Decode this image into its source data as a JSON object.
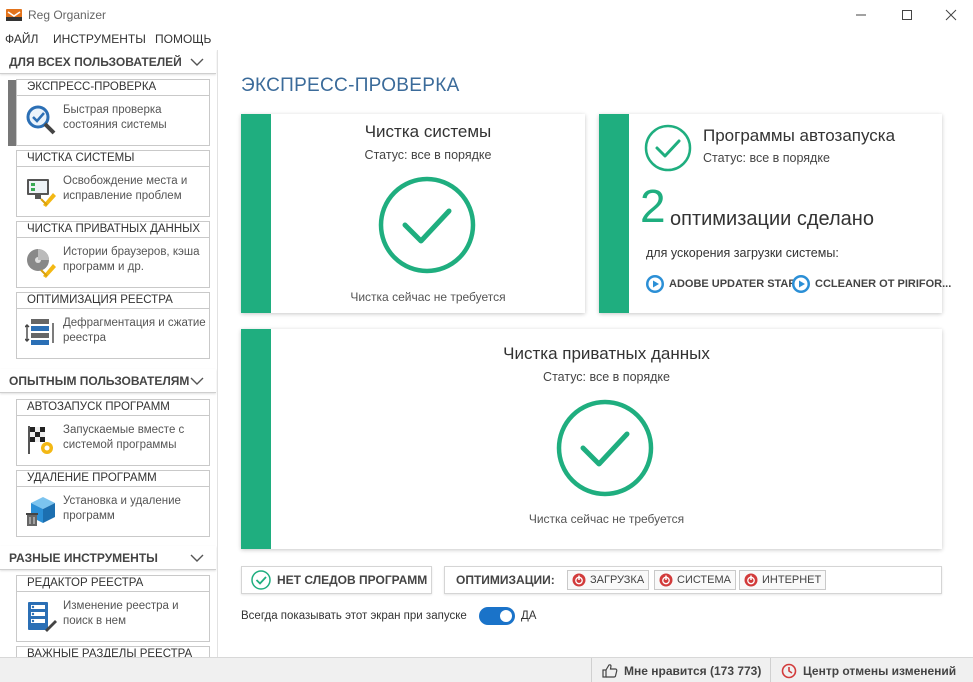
{
  "window": {
    "title": "Reg Organizer"
  },
  "menu": [
    "ФАЙЛ",
    "ИНСТРУМЕНТЫ",
    "ПОМОЩЬ"
  ],
  "sidebar": {
    "sections": [
      {
        "title": "ДЛЯ ВСЕХ ПОЛЬЗОВАТЕЛЕЙ",
        "tools": [
          {
            "name": "ЭКСПРЕСС-ПРОВЕРКА",
            "desc": "Быстрая проверка состояния системы",
            "icon": "magnifier-check-icon"
          },
          {
            "name": "ЧИСТКА СИСТЕМЫ",
            "desc": "Освобождение места и исправление проблем",
            "icon": "monitor-broom-icon"
          },
          {
            "name": "ЧИСТКА ПРИВАТНЫХ ДАННЫХ",
            "desc": "Истории браузеров, кэша программ и др.",
            "icon": "disk-broom-icon"
          },
          {
            "name": "ОПТИМИЗАЦИЯ РЕЕСТРА",
            "desc": "Дефрагментация и сжатие реестра",
            "icon": "registry-compress-icon"
          }
        ]
      },
      {
        "title": "ОПЫТНЫМ ПОЛЬЗОВАТЕЛЯМ",
        "tools": [
          {
            "name": "АВТОЗАПУСК ПРОГРАММ",
            "desc": "Запускаемые вместе с системой программы",
            "icon": "checkered-flag-gear-icon"
          },
          {
            "name": "УДАЛЕНИЕ ПРОГРАММ",
            "desc": "Установка и удаление программ",
            "icon": "box-trash-icon"
          }
        ]
      },
      {
        "title": "РАЗНЫЕ ИНСТРУМЕНТЫ",
        "tools": [
          {
            "name": "РЕДАКТОР РЕЕСТРА",
            "desc": "Изменение реестра и поиск в нем",
            "icon": "registry-editor-icon"
          },
          {
            "name": "ВАЖНЫЕ РАЗДЕЛЫ РЕЕСТРА",
            "desc": "",
            "icon": ""
          }
        ]
      }
    ]
  },
  "main": {
    "title": "ЭКСПРЕСС-ПРОВЕРКА",
    "system_clean": {
      "title": "Чистка системы",
      "status": "Статус: все в порядке",
      "foot": "Чистка сейчас не требуется"
    },
    "autorun": {
      "title": "Программы автозапуска",
      "status": "Статус: все в порядке",
      "count": "2",
      "count_text": "оптимизации сделано",
      "subtitle": "для ускорения загрузки системы:",
      "programs": [
        "ADOBE UPDATER STAR...",
        "CCLEANER OT PIRIFOR..."
      ]
    },
    "private_clean": {
      "title": "Чистка приватных данных",
      "status": "Статус: все в порядке",
      "foot": "Чистка сейчас не требуется"
    },
    "no_traces": "НЕТ СЛЕДОВ ПРОГРАММ",
    "optimizations": {
      "label": "ОПТИМИЗАЦИИ:",
      "buttons": [
        "ЗАГРУЗКА",
        "СИСТЕМА",
        "ИНТЕРНЕТ"
      ]
    },
    "always_show": "Всегда показывать этот экран при запуске",
    "toggle_label": "ДА"
  },
  "statusbar": {
    "like": "Мне нравится (173 773)",
    "undo": "Центр отмены изменений"
  },
  "colors": {
    "accent_green": "#1fae7f",
    "title_blue": "#3b6b9a",
    "toggle_blue": "#1a73c9",
    "alert_red": "#d23b3b"
  }
}
